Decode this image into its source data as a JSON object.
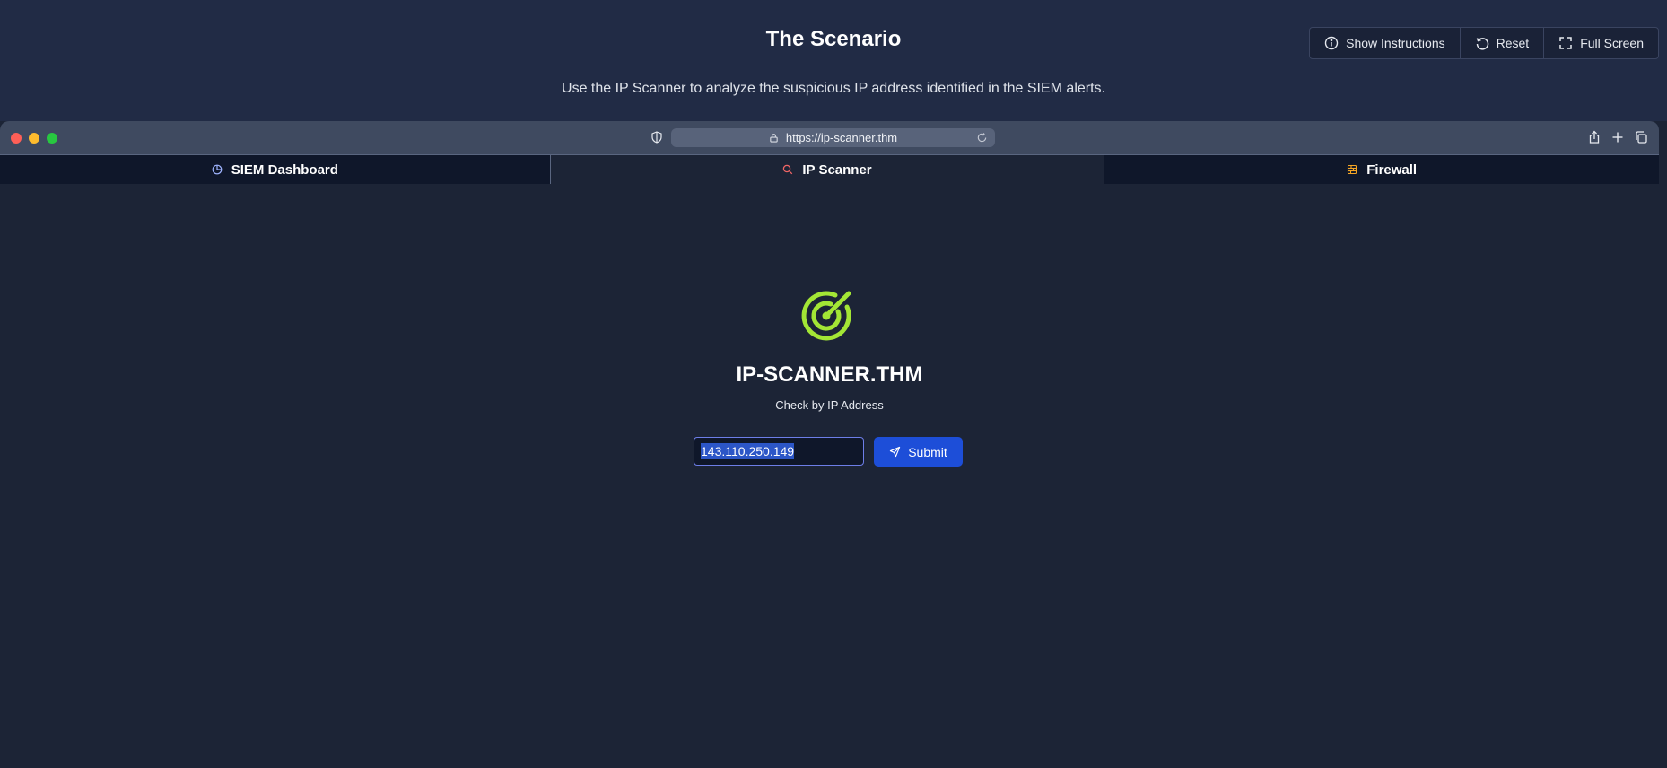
{
  "header": {
    "title": "The Scenario",
    "description": "Use the IP Scanner to analyze the suspicious IP address identified in the SIEM alerts."
  },
  "toolbar": {
    "show_instructions": "Show Instructions",
    "reset": "Reset",
    "full_screen": "Full Screen"
  },
  "browser": {
    "url": "https://ip-scanner.thm"
  },
  "tabs": [
    {
      "label": "SIEM Dashboard",
      "icon": "pie-chart-icon",
      "active": false
    },
    {
      "label": "IP Scanner",
      "icon": "search-icon",
      "active": true
    },
    {
      "label": "Firewall",
      "icon": "firewall-icon",
      "active": false
    }
  ],
  "scanner": {
    "brand": "IP-SCANNER.THM",
    "subtitle": "Check by IP Address",
    "input_value": "143.110.250.149",
    "submit_label": "Submit"
  },
  "colors": {
    "accent_green": "#a3e635",
    "submit_blue": "#1d4ed8",
    "background": "#1c2436"
  }
}
